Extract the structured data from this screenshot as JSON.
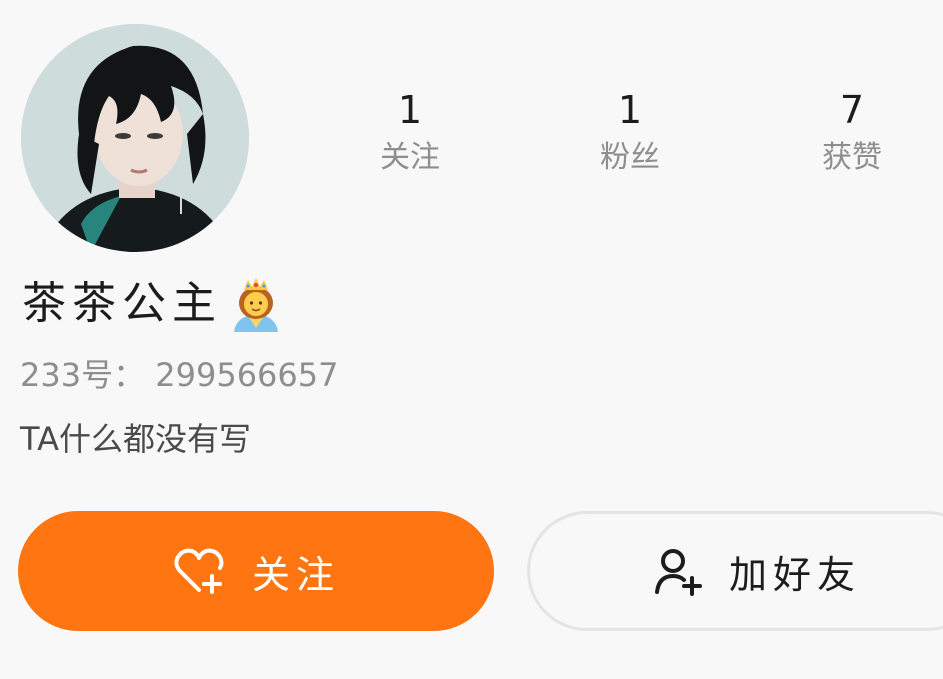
{
  "profile": {
    "name": "茶茶公主",
    "id_line": "233号： 299566657",
    "bio": "TA什么都没有写"
  },
  "stats": [
    {
      "value": "1",
      "label": "关注"
    },
    {
      "value": "1",
      "label": "粉丝"
    },
    {
      "value": "7",
      "label": "获赞"
    }
  ],
  "actions": {
    "follow_label": "关注",
    "add_friend_label": "加好友"
  },
  "icons": {
    "follow": "heart-plus-icon",
    "add_friend": "user-plus-icon",
    "name_badge": "princess-emoji-icon"
  },
  "colors": {
    "accent": "#ff7512",
    "text_primary": "#1c1c1c",
    "text_secondary": "#8e8e8e",
    "background": "#f8f8f8"
  }
}
